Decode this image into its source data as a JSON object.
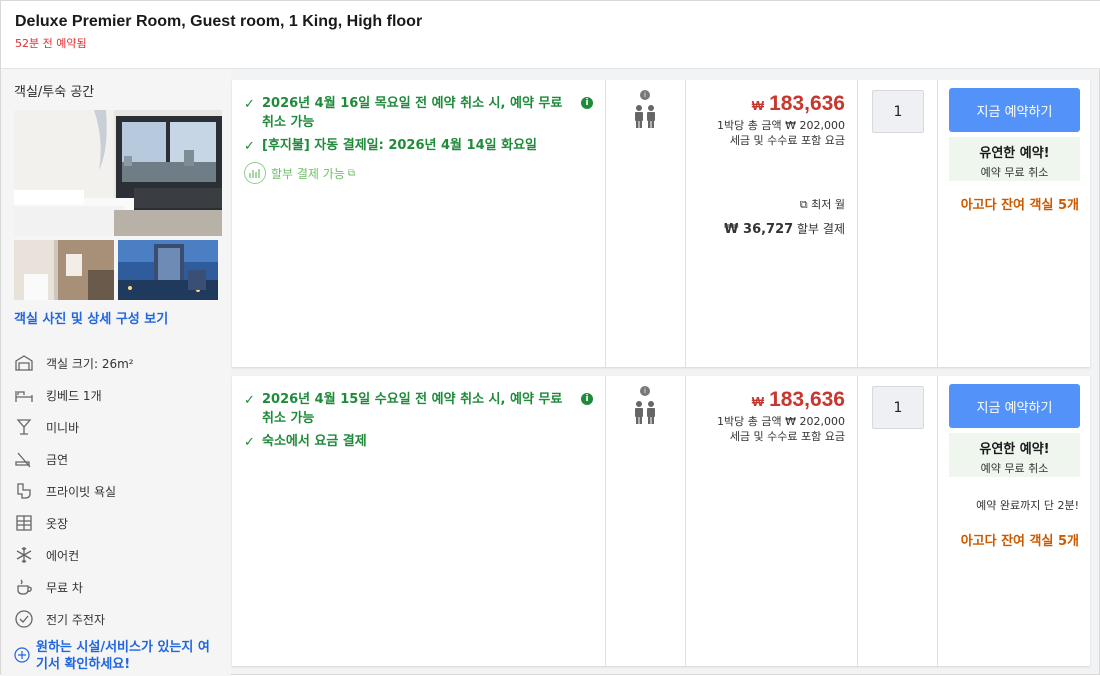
{
  "header": {
    "room_title": "Deluxe Premier Room, Guest room, 1 King, High floor",
    "booked_ago": "52분 전 예약됨"
  },
  "left": {
    "section_label": "객실/투숙 공간",
    "photos_link": "객실 사진 및 상세 구성 보기",
    "amenities": [
      {
        "icon": "room-size-icon",
        "label": "객실 크기: 26m²"
      },
      {
        "icon": "bed-icon",
        "label": "킹베드 1개"
      },
      {
        "icon": "minibar-icon",
        "label": "미니바"
      },
      {
        "icon": "no-smoking-icon",
        "label": "금연"
      },
      {
        "icon": "bathroom-icon",
        "label": "프라이빗 욕실"
      },
      {
        "icon": "closet-icon",
        "label": "옷장"
      },
      {
        "icon": "air-conditioning-icon",
        "label": "에어컨"
      },
      {
        "icon": "tea-icon",
        "label": "무료 차"
      },
      {
        "icon": "check-circle-icon",
        "label": "전기 주전자"
      }
    ],
    "more_link": "원하는 시설/서비스가 있는지 여기서 확인하세요!"
  },
  "offers": [
    {
      "conditions": [
        "2026년 4월 16일 목요일 전 예약 취소 시, 예약 무료 취소 가능",
        "[후지불] 자동 결제일: 2026년 4월 14일 화요일"
      ],
      "installment_label": "할부 결제 가능",
      "price": {
        "currency": "₩",
        "amount": "183,636",
        "per_night_total": "1박당 총 금액 ₩ 202,000",
        "tax_note": "세금 및 수수료 포함 요금",
        "lowest_monthly_label": "최저 월",
        "installment_amount": "₩ 36,727",
        "installment_suffix": "할부 결제"
      },
      "quantity": "1",
      "book_button": "지금 예약하기",
      "flex_title": "유연한 예약!",
      "flex_sub": "예약 무료 취소",
      "rooms_left": "아고다 잔여 객실 5개"
    },
    {
      "conditions": [
        "2026년 4월 15일 수요일 전 예약 취소 시, 예약 무료 취소 가능",
        "숙소에서 요금 결제"
      ],
      "price": {
        "currency": "₩",
        "amount": "183,636",
        "per_night_total": "1박당 총 금액 ₩ 202,000",
        "tax_note": "세금 및 수수료 포함 요금"
      },
      "quantity": "1",
      "book_button": "지금 예약하기",
      "flex_title": "유연한 예약!",
      "flex_sub": "예약 무료 취소",
      "hurry_note": "예약 완료까지 단 2분!",
      "rooms_left": "아고다 잔여 객실 5개"
    }
  ]
}
